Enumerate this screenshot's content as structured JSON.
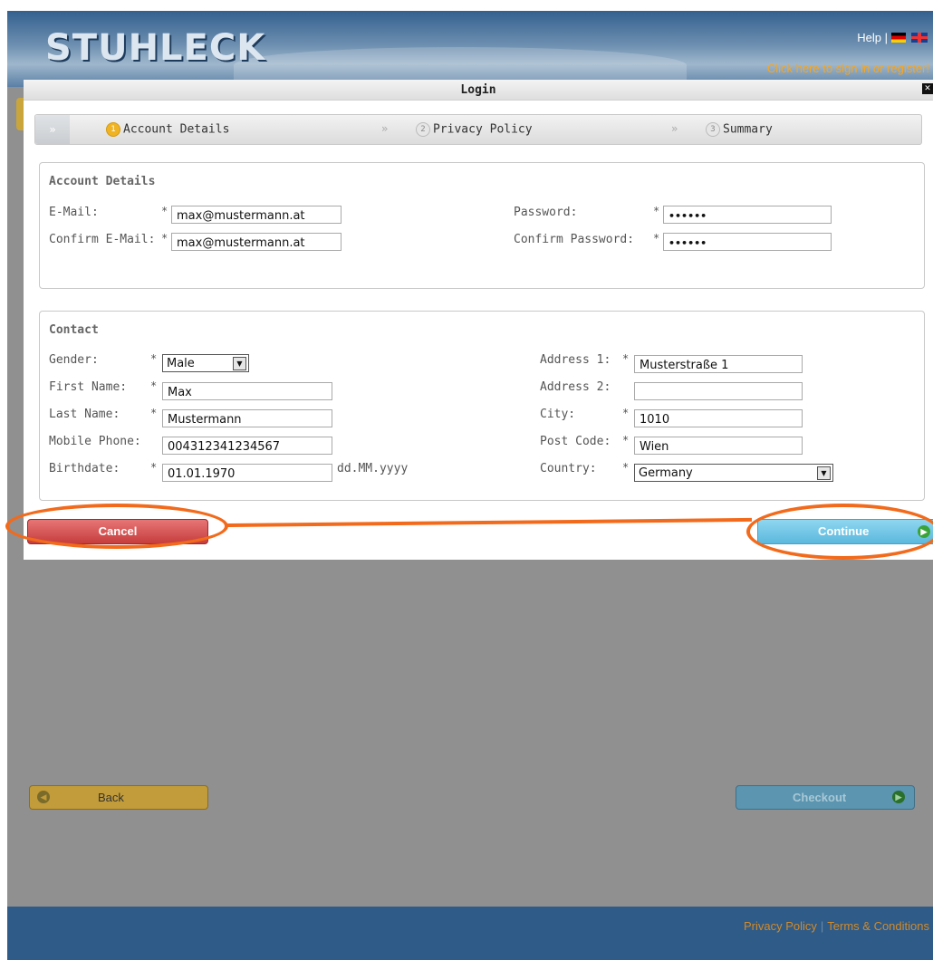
{
  "header": {
    "logo": "STUHLECK",
    "help_label": "Help |",
    "signin_label": "Click here to sign in or register!"
  },
  "page": {
    "back_label": "Back",
    "checkout_label": "Checkout"
  },
  "footer": {
    "privacy_label": "Privacy Policy",
    "separator": "|",
    "terms_label": "Terms & Conditions"
  },
  "modal": {
    "title": "Login",
    "steps": [
      {
        "num": "1",
        "label": "Account Details",
        "active": true
      },
      {
        "num": "2",
        "label": "Privacy Policy",
        "active": false
      },
      {
        "num": "3",
        "label": "Summary",
        "active": false
      }
    ],
    "step_separator": "»",
    "account": {
      "title": "Account Details",
      "email_label": "E-Mail:",
      "email_value": "max@mustermann.at",
      "confirm_email_label": "Confirm E-Mail:",
      "confirm_email_value": "max@mustermann.at",
      "password_label": "Password:",
      "password_value": "••••••",
      "confirm_password_label": "Confirm Password:",
      "confirm_password_value": "••••••"
    },
    "contact": {
      "title": "Contact",
      "gender_label": "Gender:",
      "gender_value": "Male",
      "first_name_label": "First Name:",
      "first_name_value": "Max",
      "last_name_label": "Last Name:",
      "last_name_value": "Mustermann",
      "mobile_label": "Mobile Phone:",
      "mobile_value": "004312341234567",
      "birthdate_label": "Birthdate:",
      "birthdate_value": "01.01.1970",
      "birthdate_hint": "dd.MM.yyyy",
      "address1_label": "Address 1:",
      "address1_value": "Musterstraße 1",
      "address2_label": "Address 2:",
      "address2_value": "",
      "city_label": "City:",
      "city_value": "1010",
      "postcode_label": "Post Code:",
      "postcode_value": "Wien",
      "country_label": "Country:",
      "country_value": "Germany"
    },
    "required_mark": "*",
    "cancel_label": "Cancel",
    "continue_label": "Continue"
  },
  "colors": {
    "annotation": "#f26a1b",
    "cancel": "#c63d3d",
    "continue": "#5bb8dd",
    "step_active": "#f0b323"
  }
}
